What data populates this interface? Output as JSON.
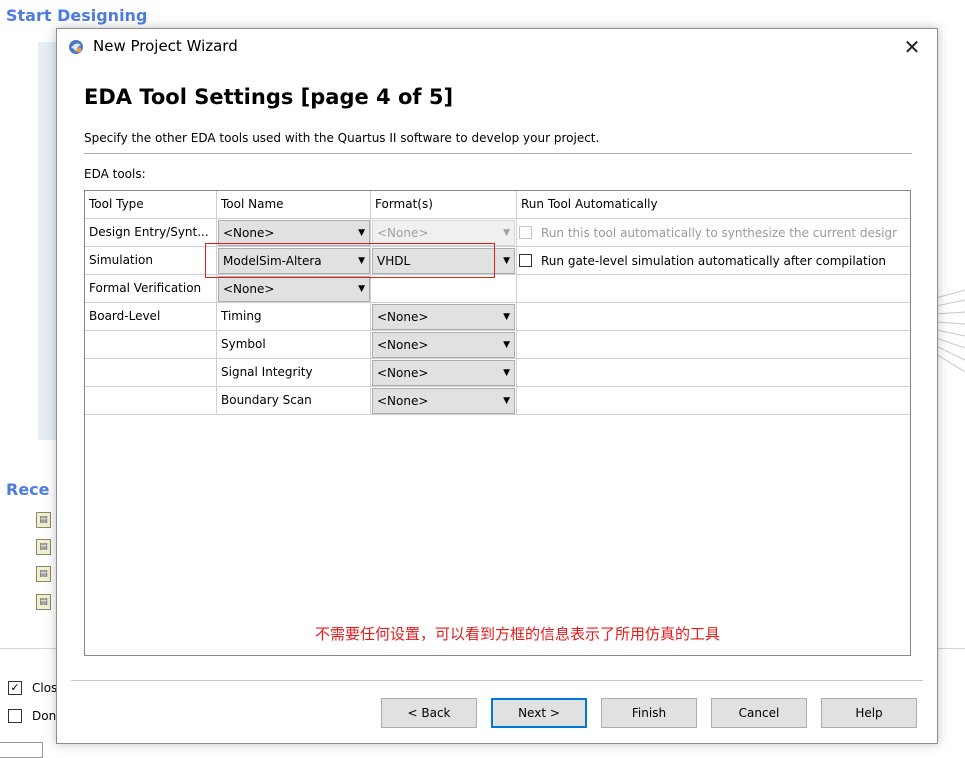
{
  "background": {
    "title": "Start Designing",
    "recent_label": "Rece",
    "checkbox_close": {
      "label": "Clos",
      "checked": true
    },
    "checkbox_dont": {
      "label": "Don",
      "checked": false
    }
  },
  "dialog": {
    "title": "New Project Wizard",
    "heading": "EDA Tool Settings [page 4 of 5]",
    "description": "Specify the other EDA tools used with the Quartus II software to develop your project.",
    "eda_label": "EDA tools:",
    "table": {
      "headers": [
        "Tool Type",
        "Tool Name",
        "Format(s)",
        "Run Tool Automatically"
      ],
      "rows": [
        {
          "type": "Design Entry/Synt...",
          "tool": "<None>",
          "format": "<None>",
          "run": "Run this tool automatically to synthesize the current desigr"
        },
        {
          "type": "Simulation",
          "tool": "ModelSim-Altera",
          "format": "VHDL",
          "run": "Run gate-level simulation automatically after compilation"
        },
        {
          "type": "Formal Verification",
          "tool": "<None>",
          "format": "",
          "run": ""
        },
        {
          "type": "Board-Level",
          "tool": "Timing",
          "format": "<None>",
          "run": ""
        },
        {
          "type": "",
          "tool": "Symbol",
          "format": "<None>",
          "run": ""
        },
        {
          "type": "",
          "tool": "Signal Integrity",
          "format": "<None>",
          "run": ""
        },
        {
          "type": "",
          "tool": "Boundary Scan",
          "format": "<None>",
          "run": ""
        }
      ]
    },
    "annotation": "不需要任何设置，可以看到方框的信息表示了所用仿真的工具",
    "buttons": {
      "back": "< Back",
      "next": "Next >",
      "finish": "Finish",
      "cancel": "Cancel",
      "help": "Help"
    },
    "colors": {
      "accent": "#0078d7",
      "annotation": "#e81b1b",
      "highlight_box": "#e01e1e",
      "bg_heading": "#4d7de0"
    }
  }
}
